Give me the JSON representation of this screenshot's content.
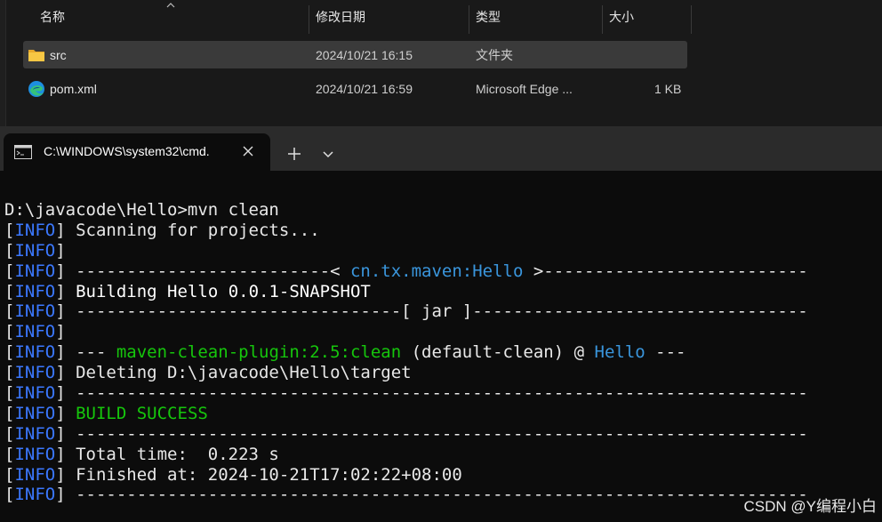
{
  "explorer": {
    "columns": [
      "名称",
      "修改日期",
      "类型",
      "大小"
    ],
    "files": [
      {
        "name": "src",
        "modified": "2024/10/21 16:15",
        "type": "文件夹",
        "size": "",
        "icon": "folder-icon",
        "selected": true
      },
      {
        "name": "pom.xml",
        "modified": "2024/10/21 16:59",
        "type": "Microsoft Edge ...",
        "size": "1 KB",
        "icon": "edge-icon",
        "selected": false
      }
    ]
  },
  "terminal": {
    "tab_title": "C:\\WINDOWS\\system32\\cmd.",
    "new_tab": "+",
    "colors": {
      "info": "#3b78ff",
      "success": "#16c60c",
      "artifact": "#3a96dd",
      "text": "#e8e8e8"
    },
    "lines": [
      [
        {
          "t": "D:\\javacode\\Hello>mvn clean",
          "c": ""
        }
      ],
      [
        {
          "t": "[",
          "c": ""
        },
        {
          "t": "INFO",
          "c": "b"
        },
        {
          "t": "] Scanning for projects...",
          "c": ""
        }
      ],
      [
        {
          "t": "[",
          "c": ""
        },
        {
          "t": "INFO",
          "c": "b"
        },
        {
          "t": "]",
          "c": ""
        }
      ],
      [
        {
          "t": "[",
          "c": ""
        },
        {
          "t": "INFO",
          "c": "b"
        },
        {
          "t": "] -------------------------< ",
          "c": ""
        },
        {
          "t": "cn.tx.maven:Hello",
          "c": "cy"
        },
        {
          "t": " >--------------------------",
          "c": ""
        }
      ],
      [
        {
          "t": "[",
          "c": ""
        },
        {
          "t": "INFO",
          "c": "b"
        },
        {
          "t": "] ",
          "c": ""
        },
        {
          "t": "Building Hello 0.0.1-SNAPSHOT",
          "c": "wt"
        }
      ],
      [
        {
          "t": "[",
          "c": ""
        },
        {
          "t": "INFO",
          "c": "b"
        },
        {
          "t": "] --------------------------------[ jar ]---------------------------------",
          "c": ""
        }
      ],
      [
        {
          "t": "[",
          "c": ""
        },
        {
          "t": "INFO",
          "c": "b"
        },
        {
          "t": "]",
          "c": ""
        }
      ],
      [
        {
          "t": "[",
          "c": ""
        },
        {
          "t": "INFO",
          "c": "b"
        },
        {
          "t": "] --- ",
          "c": ""
        },
        {
          "t": "maven-clean-plugin:2.5:clean",
          "c": "g"
        },
        {
          "t": " (default-clean) @ ",
          "c": ""
        },
        {
          "t": "Hello",
          "c": "cy"
        },
        {
          "t": " ---",
          "c": ""
        }
      ],
      [
        {
          "t": "[",
          "c": ""
        },
        {
          "t": "INFO",
          "c": "b"
        },
        {
          "t": "] Deleting D:\\javacode\\Hello\\target",
          "c": ""
        }
      ],
      [
        {
          "t": "[",
          "c": ""
        },
        {
          "t": "INFO",
          "c": "b"
        },
        {
          "t": "] ------------------------------------------------------------------------",
          "c": ""
        }
      ],
      [
        {
          "t": "[",
          "c": ""
        },
        {
          "t": "INFO",
          "c": "b"
        },
        {
          "t": "] ",
          "c": ""
        },
        {
          "t": "BUILD SUCCESS",
          "c": "g"
        }
      ],
      [
        {
          "t": "[",
          "c": ""
        },
        {
          "t": "INFO",
          "c": "b"
        },
        {
          "t": "] ------------------------------------------------------------------------",
          "c": ""
        }
      ],
      [
        {
          "t": "[",
          "c": ""
        },
        {
          "t": "INFO",
          "c": "b"
        },
        {
          "t": "] Total time:  0.223 s",
          "c": ""
        }
      ],
      [
        {
          "t": "[",
          "c": ""
        },
        {
          "t": "INFO",
          "c": "b"
        },
        {
          "t": "] Finished at: 2024-10-21T17:02:22+08:00",
          "c": ""
        }
      ],
      [
        {
          "t": "[",
          "c": ""
        },
        {
          "t": "INFO",
          "c": "b"
        },
        {
          "t": "] ------------------------------------------------------------------------",
          "c": ""
        }
      ]
    ]
  },
  "watermark": "CSDN @Y编程小白"
}
